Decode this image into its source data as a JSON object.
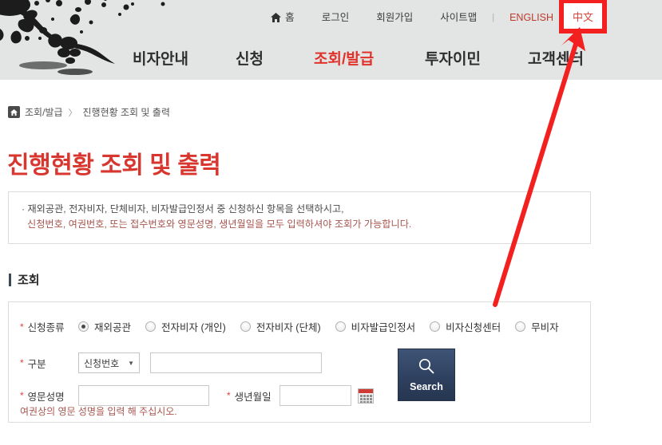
{
  "header": {
    "util_nav": [
      {
        "label": "홈",
        "icon": "home-icon",
        "kind": "home"
      },
      {
        "label": "로그인",
        "kind": "plain"
      },
      {
        "label": "회원가입",
        "kind": "plain"
      },
      {
        "label": "사이트맵",
        "kind": "plain"
      },
      {
        "label": "|",
        "kind": "separator"
      },
      {
        "label": "ENGLISH",
        "kind": "english"
      },
      {
        "label": "中文",
        "kind": "chinese"
      }
    ],
    "main_nav": [
      {
        "label": "비자안내",
        "active": false
      },
      {
        "label": "신청",
        "active": false
      },
      {
        "label": "조회/발급",
        "active": true
      },
      {
        "label": "투자이민",
        "active": false
      },
      {
        "label": "고객센터",
        "active": false
      }
    ],
    "decoration": "ink-brush-plum-blossom-artwork"
  },
  "breadcrumb": {
    "home_icon": "home-icon",
    "separator": "〉",
    "items": [
      "조회/발급",
      "진행현황 조회 및 출력"
    ]
  },
  "page": {
    "title": "진행현황 조회 및 출력"
  },
  "notice": {
    "bullet": "·",
    "line1": "재외공관, 전자비자, 단체비자, 비자발급인정서 중 신청하신 항목을 선택하시고,",
    "line2": "신청번호, 여권번호, 또는 접수번호와 영문성명, 생년월일을 모두 입력하셔야 조회가 가능합니다."
  },
  "section": {
    "title": "조회"
  },
  "form": {
    "required_mark": "*",
    "application_type": {
      "label": "신청종류",
      "options": [
        {
          "label": "재외공관",
          "checked": true
        },
        {
          "label": "전자비자 (개인)",
          "checked": false
        },
        {
          "label": "전자비자 (단체)",
          "checked": false
        },
        {
          "label": "비자발급인정서",
          "checked": false
        },
        {
          "label": "비자신청센터",
          "checked": false
        },
        {
          "label": "무비자",
          "checked": false
        }
      ]
    },
    "gubun": {
      "label": "구분",
      "select_value": "신청번호",
      "select_caret": "▼",
      "input_value": "",
      "input_placeholder": ""
    },
    "english_name": {
      "label": "영문성명",
      "input_value": "",
      "input_placeholder": ""
    },
    "birth_date": {
      "label": "생년월일",
      "input_value": "",
      "input_placeholder": "",
      "calendar_icon": "calendar-icon"
    },
    "hint": "여권상의 영문 성명을 입력 해 주십시오.",
    "search_button": {
      "label": "Search",
      "icon": "search-icon"
    }
  },
  "annotation": {
    "arrow_color": "#f32020",
    "highlight_target": "中文",
    "highlight_box_color": "#f32020"
  },
  "colors": {
    "header_bg": "#e3e5e5",
    "accent_red": "#d8372f",
    "nav_active": "#e0322a",
    "notice_text": "#4c4c4c",
    "notice_text_alt": "#a8564f",
    "button_navy": "#2f4160",
    "annotation_red": "#f32020"
  }
}
